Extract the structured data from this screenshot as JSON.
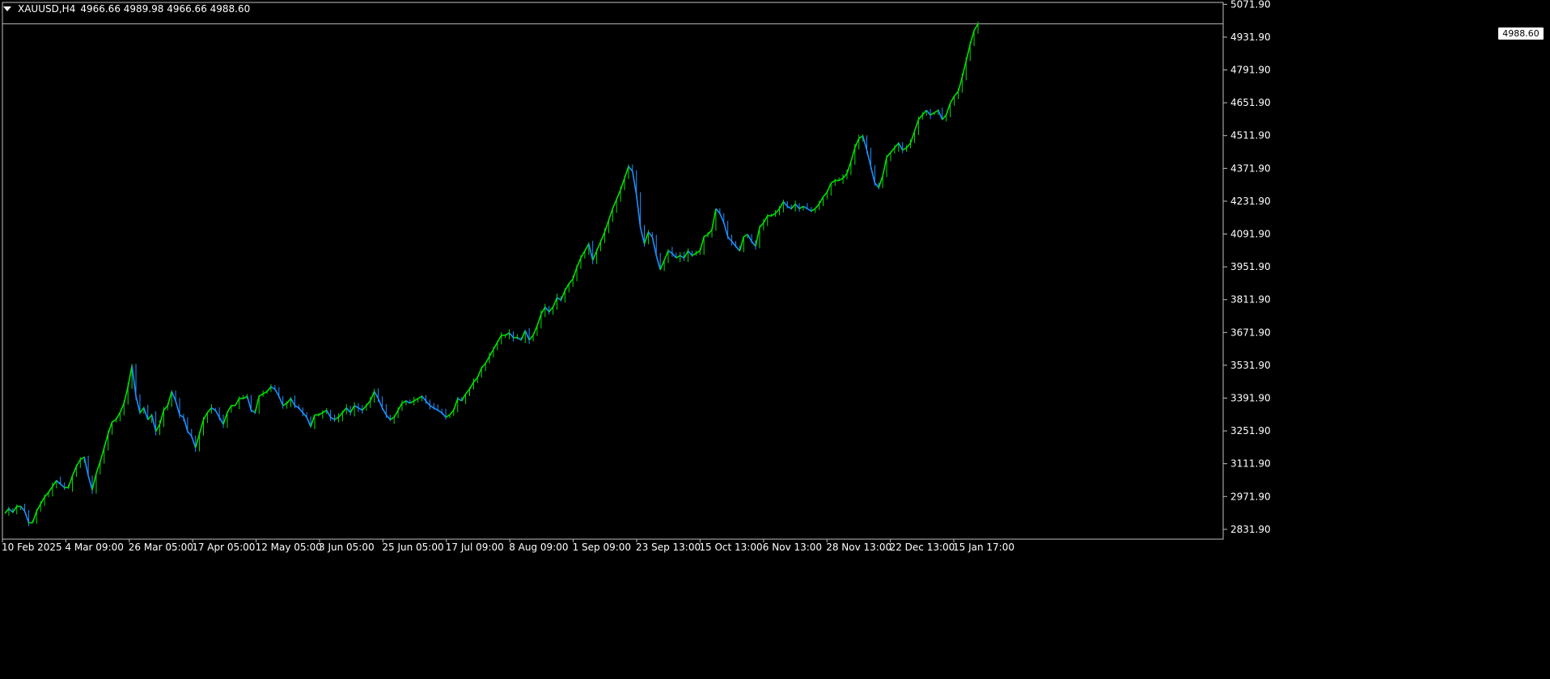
{
  "header": {
    "symbol": "XAUUSD,H4",
    "ohlc": "4966.66 4989.98 4966.66 4988.60"
  },
  "current_price_label": "4988.60",
  "colors": {
    "background": "#000000",
    "frame": "#c0c0c0",
    "bull": "#00e000",
    "bear": "#1e90ff",
    "current_line": "#b0b0b0"
  },
  "chart_data": {
    "type": "line",
    "title": "",
    "xlabel": "",
    "ylabel": "",
    "ylim": [
      2790,
      5080
    ],
    "grid": false,
    "x_tick_labels": [
      "10 Feb 2025",
      "4 Mar 09:00",
      "26 Mar 05:00",
      "17 Apr 05:00",
      "12 May 05:00",
      "3 Jun 05:00",
      "25 Jun 05:00",
      "17 Jul 09:00",
      "8 Aug 09:00",
      "1 Sep 09:00",
      "23 Sep 13:00",
      "15 Oct 13:00",
      "6 Nov 13:00",
      "28 Nov 13:00",
      "22 Dec 13:00",
      "15 Jan 17:00"
    ],
    "y_ticks": [
      5071.9,
      4931.9,
      4791.9,
      4651.9,
      4511.9,
      4371.9,
      4231.9,
      4091.9,
      3951.9,
      3811.9,
      3671.9,
      3531.9,
      3391.9,
      3251.9,
      3111.9,
      2971.9,
      2831.9
    ],
    "y_tick_labels": [
      "5071.90",
      "4931.90",
      "4791.90",
      "4651.90",
      "4511.90",
      "4371.90",
      "4231.90",
      "4091.90",
      "3951.90",
      "3811.90",
      "3671.90",
      "3531.90",
      "3391.90",
      "3251.90",
      "3111.90",
      "2971.90",
      "2831.90"
    ],
    "current_price": 4988.6,
    "series": [
      {
        "values": [
          2900,
          2920,
          2905,
          2930,
          2930,
          2910,
          2860,
          2860,
          2910,
          2940,
          2970,
          2990,
          3015,
          3040,
          3025,
          3010,
          3010,
          3060,
          3100,
          3130,
          3140,
          3060,
          3000,
          3070,
          3120,
          3180,
          3240,
          3290,
          3300,
          3330,
          3370,
          3440,
          3530,
          3400,
          3330,
          3350,
          3300,
          3320,
          3250,
          3280,
          3340,
          3360,
          3420,
          3380,
          3320,
          3310,
          3250,
          3230,
          3180,
          3240,
          3300,
          3330,
          3350,
          3340,
          3310,
          3280,
          3330,
          3360,
          3360,
          3390,
          3390,
          3400,
          3340,
          3330,
          3400,
          3410,
          3420,
          3440,
          3430,
          3400,
          3360,
          3370,
          3390,
          3360,
          3350,
          3330,
          3310,
          3270,
          3320,
          3320,
          3330,
          3340,
          3310,
          3300,
          3310,
          3330,
          3350,
          3330,
          3360,
          3350,
          3340,
          3360,
          3380,
          3420,
          3390,
          3350,
          3320,
          3300,
          3310,
          3340,
          3370,
          3380,
          3370,
          3380,
          3390,
          3400,
          3380,
          3360,
          3350,
          3340,
          3330,
          3310,
          3320,
          3340,
          3390,
          3380,
          3410,
          3430,
          3460,
          3480,
          3520,
          3540,
          3570,
          3600,
          3630,
          3660,
          3660,
          3670,
          3650,
          3650,
          3640,
          3680,
          3640,
          3660,
          3700,
          3750,
          3780,
          3760,
          3780,
          3820,
          3810,
          3850,
          3880,
          3900,
          3950,
          3990,
          4020,
          4050,
          3980,
          4020,
          4060,
          4100,
          4150,
          4200,
          4240,
          4280,
          4330,
          4380,
          4360,
          4260,
          4120,
          4050,
          4100,
          4080,
          4000,
          3940,
          3980,
          4020,
          4010,
          3990,
          4000,
          3990,
          4020,
          4000,
          4010,
          4020,
          4080,
          4090,
          4110,
          4200,
          4180,
          4140,
          4080,
          4060,
          4040,
          4020,
          4080,
          4090,
          4060,
          4040,
          4120,
          4140,
          4170,
          4170,
          4180,
          4200,
          4230,
          4210,
          4200,
          4220,
          4200,
          4210,
          4200,
          4190,
          4200,
          4220,
          4250,
          4270,
          4310,
          4320,
          4320,
          4330,
          4350,
          4400,
          4460,
          4500,
          4510,
          4450,
          4380,
          4310,
          4290,
          4340,
          4420,
          4440,
          4460,
          4480,
          4450,
          4460,
          4480,
          4530,
          4580,
          4600,
          4620,
          4600,
          4610,
          4620,
          4580,
          4600,
          4650,
          4680,
          4700,
          4760,
          4830,
          4900,
          4960,
          4988.6
        ]
      }
    ]
  }
}
